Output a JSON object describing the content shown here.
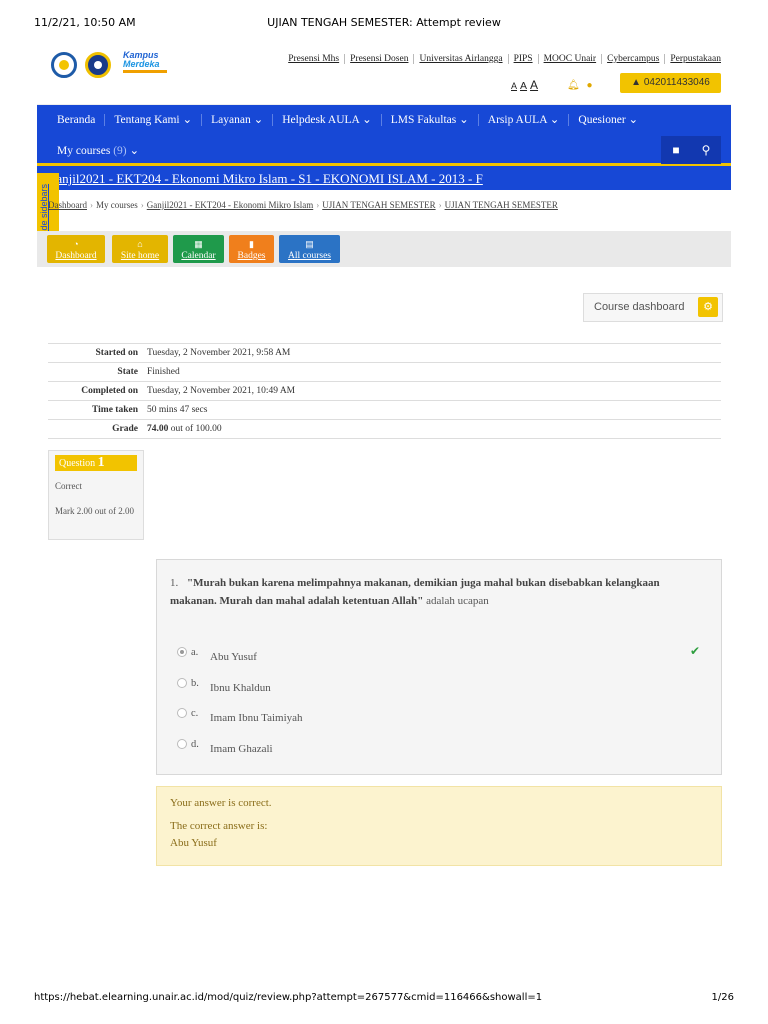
{
  "print": {
    "datetime": "11/2/21, 10:50 AM",
    "page_title": "UJIAN TENGAH SEMESTER: Attempt review",
    "url": "https://hebat.elearning.unair.ac.id/mod/quiz/review.php?attempt=267577&cmid=116466&showall=1",
    "page_num": "1/26"
  },
  "header": {
    "brand_line1": "Kampus",
    "brand_line2": "Merdeka",
    "top_links": [
      "Presensi Mhs",
      "Presensi Dosen",
      "Universitas Airlangga",
      "PIPS",
      "MOOC Unair",
      "Cybercampus",
      "Perpustakaan"
    ],
    "font_sizes": [
      "A",
      "A",
      "A"
    ],
    "user_id": "042011433046",
    "bell_icon": "bell-icon",
    "chat_icon": "chat-icon",
    "user_icon": "user-icon"
  },
  "nav": {
    "items": [
      "Beranda",
      "Tentang Kami ⌄",
      "Layanan ⌄",
      "Helpdesk AULA ⌄",
      "LMS Fakultas ⌄",
      "Arsip AULA ⌄",
      "Quesioner ⌄"
    ],
    "my_courses": "My courses",
    "my_courses_count": "(9)",
    "bookmark_icon": "bookmark-icon",
    "search_icon": "search-icon"
  },
  "course": {
    "title": "Ganjil2021 - EKT204 - Ekonomi Mikro Islam - S1 - EKONOMI ISLAM - 2013 - F",
    "hide_sidebar": "Hide sidebars"
  },
  "breadcrumb": [
    "Dashboard",
    "My courses",
    "Ganjil2021 - EKT204 - Ekonomi Mikro Islam",
    "UJIAN TENGAH SEMESTER",
    "UJIAN TENGAH SEMESTER"
  ],
  "tiles": [
    {
      "label": "Dashboard",
      "icon": "dashboard-icon",
      "color": "#e3b500"
    },
    {
      "label": "Site home",
      "icon": "home-icon",
      "color": "#e3b500"
    },
    {
      "label": "Calendar",
      "icon": "calendar-icon",
      "color": "#1f9a4b"
    },
    {
      "label": "Badges",
      "icon": "badge-icon",
      "color": "#f07f1c"
    },
    {
      "label": "All courses",
      "icon": "book-icon",
      "color": "#2b73c5"
    }
  ],
  "course_dashboard": "Course dashboard",
  "summary": [
    {
      "key": "Started on",
      "value": "Tuesday, 2 November 2021, 9:58 AM"
    },
    {
      "key": "State",
      "value": "Finished"
    },
    {
      "key": "Completed on",
      "value": "Tuesday, 2 November 2021, 10:49 AM"
    },
    {
      "key": "Time taken",
      "value": "50 mins 47 secs"
    },
    {
      "key": "Grade",
      "value_bold": "74.00",
      "value_rest": " out of 100.00"
    }
  ],
  "question_info": {
    "label": "Question",
    "number": "1",
    "state": "Correct",
    "mark": "Mark 2.00 out of 2.00"
  },
  "question": {
    "number": "1.",
    "quote_bold": "\"Murah bukan karena melimpahnya makanan, demikian juga mahal bukan disebabkan kelangkaan makanan. Murah dan mahal adalah ketentuan Allah\"",
    "tail": " adalah ucapan",
    "options": [
      {
        "letter": "a.",
        "text": "Abu Yusuf",
        "selected": true
      },
      {
        "letter": "b.",
        "text": "Ibnu Khaldun",
        "selected": false
      },
      {
        "letter": "c.",
        "text": "Imam Ibnu Taimiyah",
        "selected": false
      },
      {
        "letter": "d.",
        "text": "Imam Ghazali",
        "selected": false
      }
    ],
    "check_icon": "check-icon"
  },
  "feedback": {
    "result": "Your answer is correct.",
    "correct_label": "The correct answer is:",
    "correct_answer": "Abu Yusuf"
  }
}
